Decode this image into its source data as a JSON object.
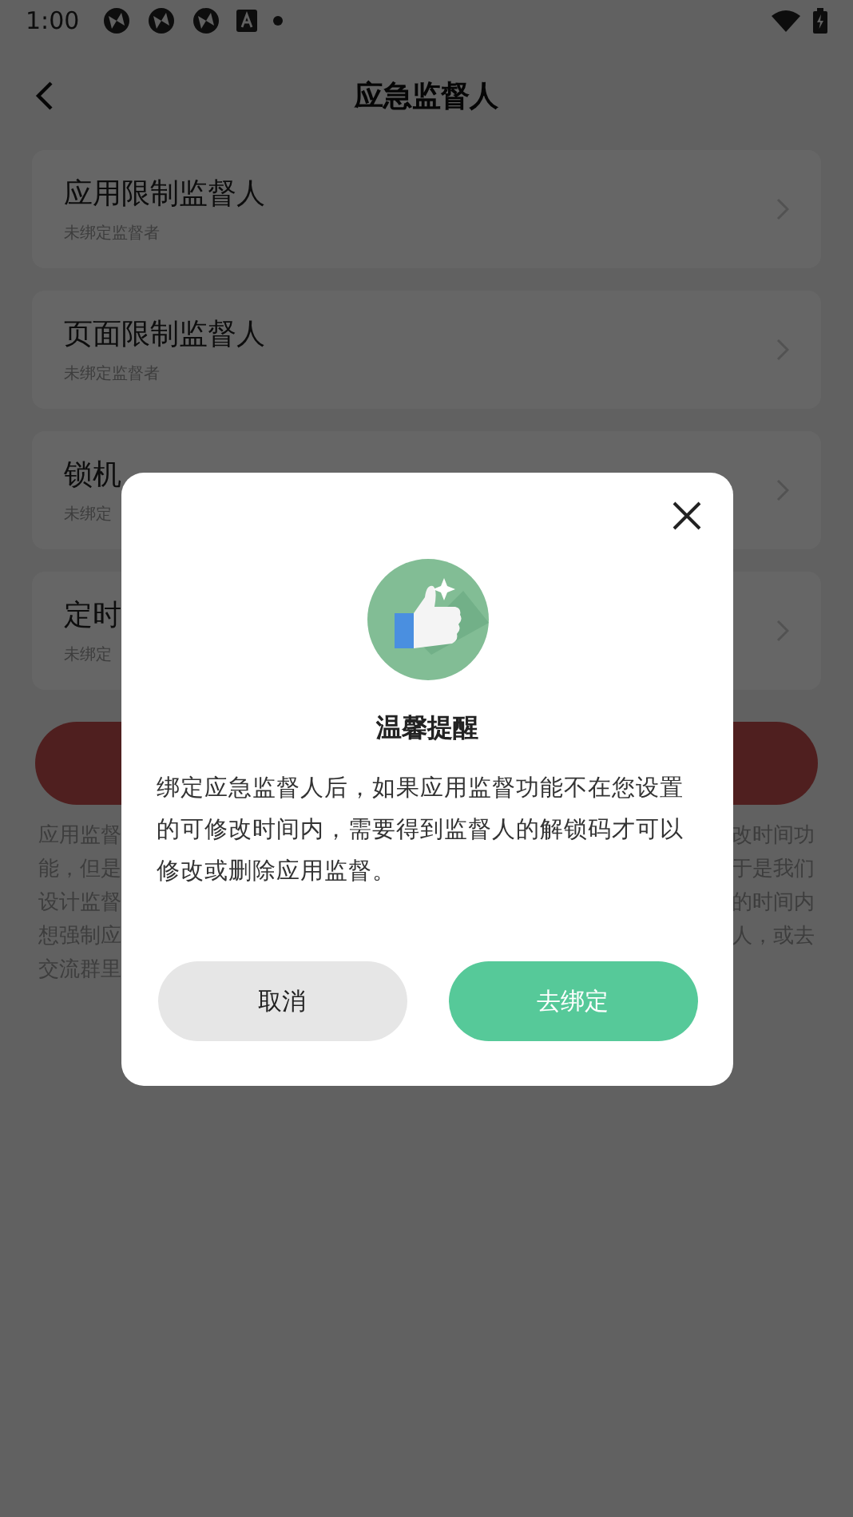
{
  "status_bar": {
    "time": "1:00"
  },
  "header": {
    "title": "应急监督人"
  },
  "items": [
    {
      "title": "应用限制监督人",
      "subtitle": "未绑定监督者"
    },
    {
      "title": "页面限制监督人",
      "subtitle": "未绑定监督者"
    },
    {
      "title": "锁机",
      "subtitle": "未绑定"
    },
    {
      "title": "定时",
      "subtitle": "未绑定"
    }
  ],
  "notice_lines": [
    {
      "left": "应用监督",
      "right": "改时间功"
    },
    {
      "left": "能，但是",
      "right": "于是我们"
    },
    {
      "left": "设计监督",
      "right": "的时间内"
    },
    {
      "left": "想强制应",
      "right": "人，或去"
    },
    {
      "left": "交流群里"
    }
  ],
  "dialog": {
    "title": "温馨提醒",
    "message": "绑定应急监督人后，如果应用监督功能不在您设置的可修改时间内，需要得到监督人的解锁码才可以修改或删除应用监督。",
    "buttons": [
      {
        "label": "取消",
        "kind": "cancel"
      },
      {
        "label": "去绑定",
        "kind": "confirm"
      }
    ]
  }
}
